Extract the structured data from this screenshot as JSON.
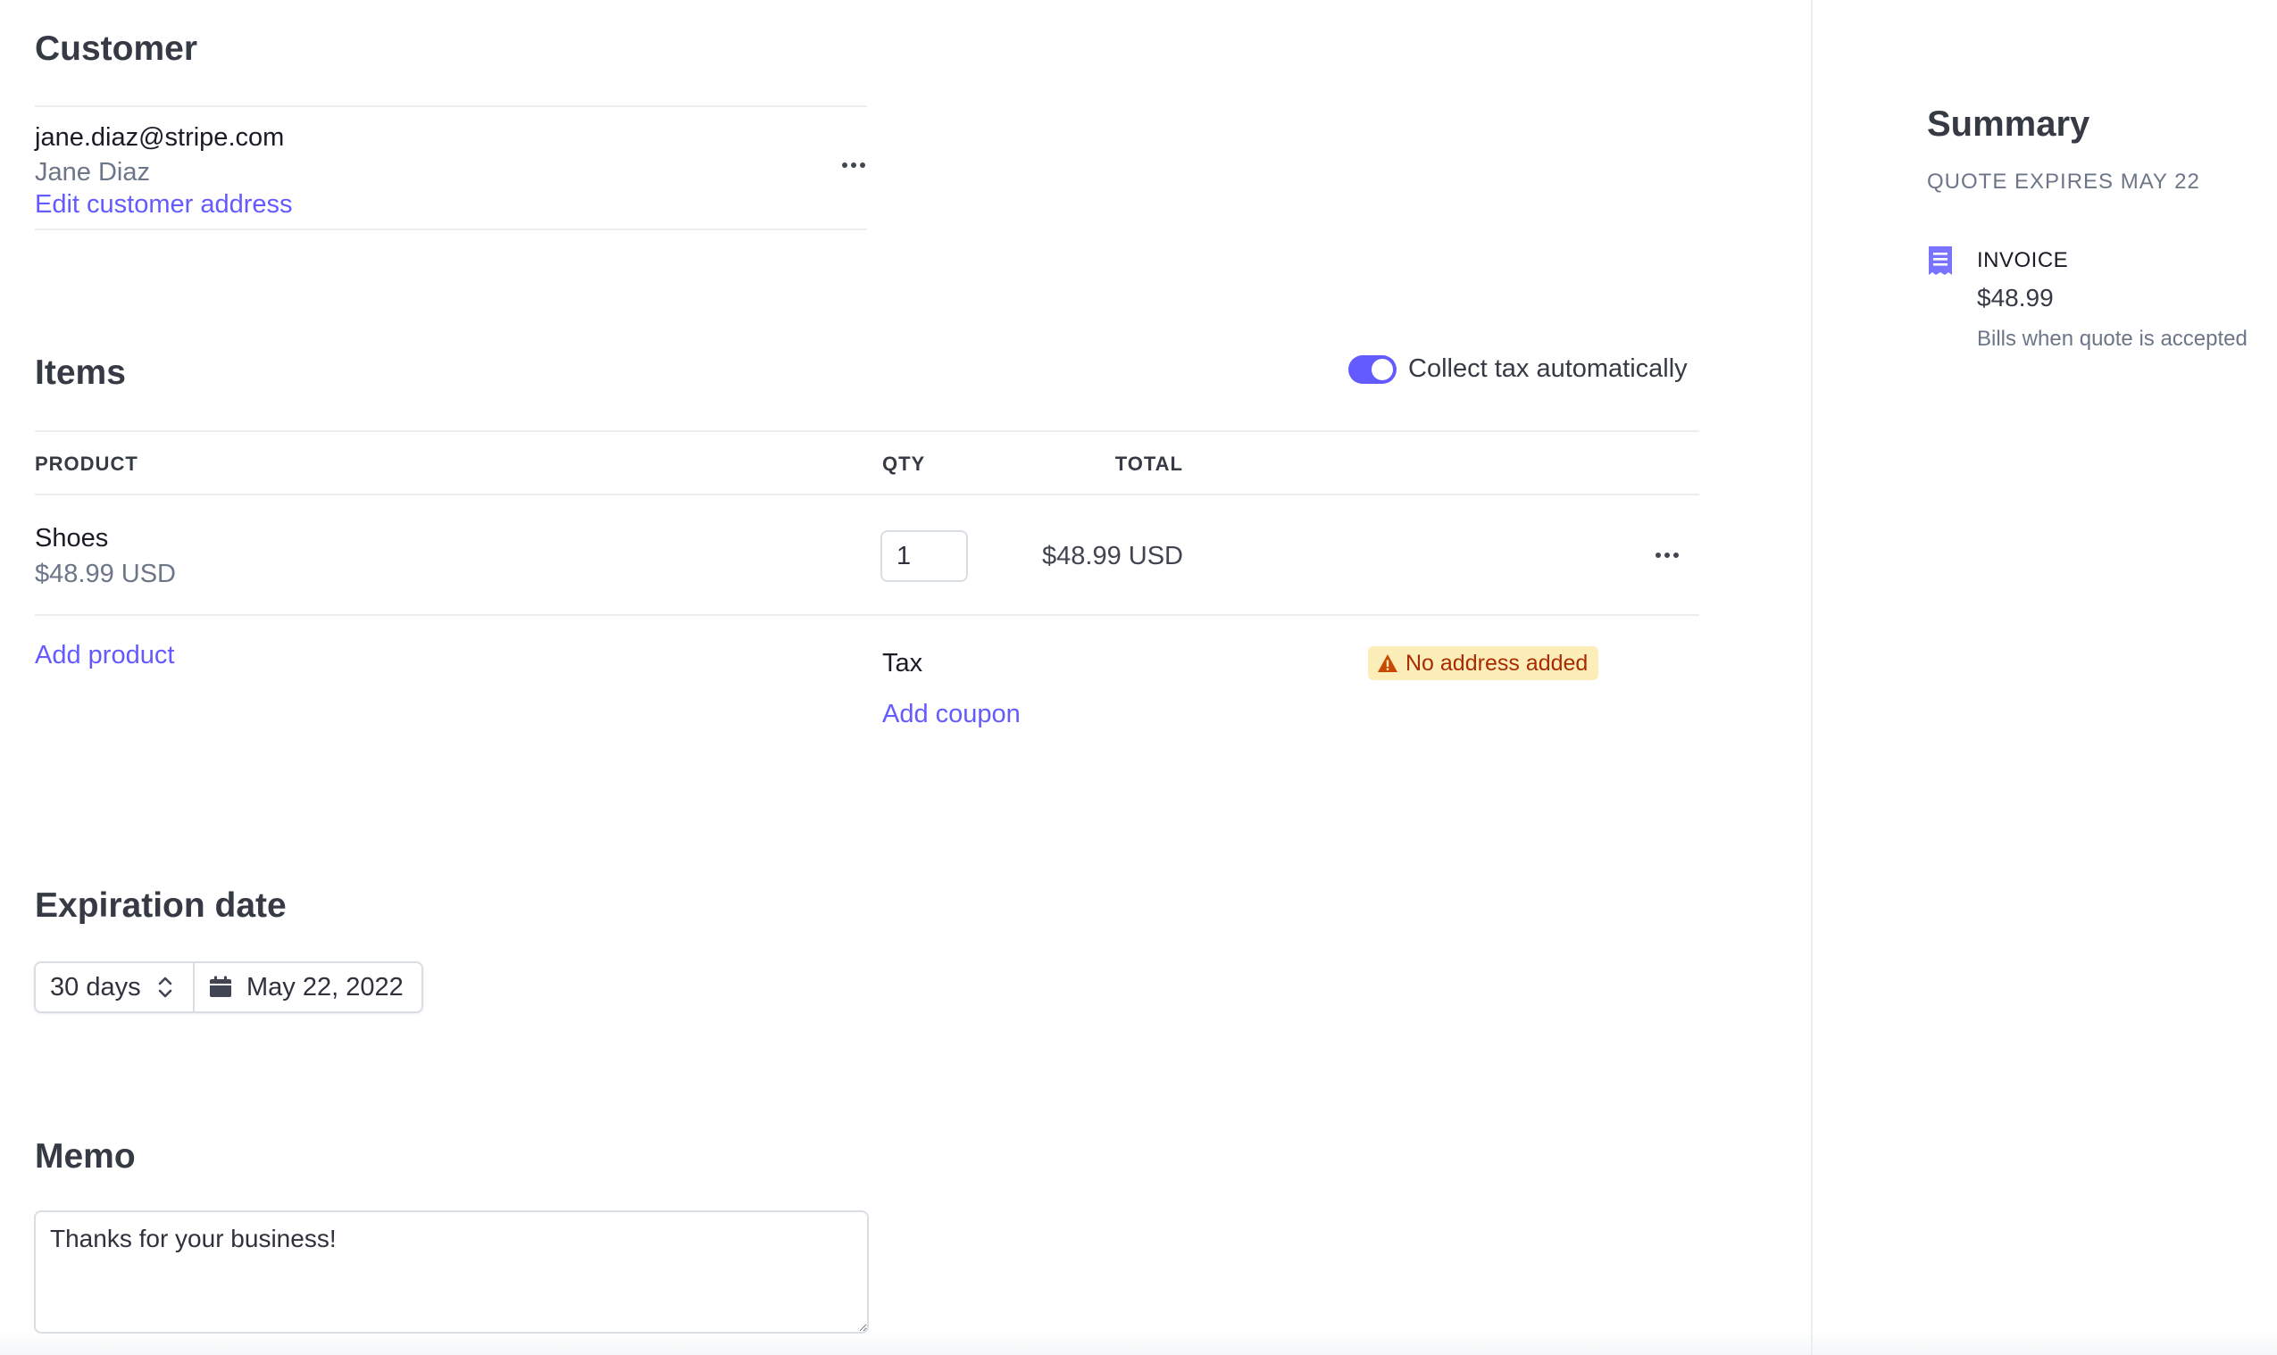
{
  "customer": {
    "heading": "Customer",
    "email": "jane.diaz@stripe.com",
    "name": "Jane Diaz",
    "edit_link": "Edit customer address",
    "more_icon": "more-horizontal-icon"
  },
  "items": {
    "heading": "Items",
    "collect_tax_label": "Collect tax automatically",
    "collect_tax_enabled": true,
    "columns": {
      "product": "PRODUCT",
      "qty": "QTY",
      "total": "TOTAL"
    },
    "rows": [
      {
        "name": "Shoes",
        "price": "$48.99 USD",
        "qty": "1",
        "total": "$48.99 USD"
      }
    ],
    "add_product": "Add product",
    "tax_label": "Tax",
    "tax_badge": "No address added",
    "add_coupon": "Add coupon"
  },
  "expiration": {
    "heading": "Expiration date",
    "duration": "30 days",
    "date": "May 22, 2022"
  },
  "memo": {
    "heading": "Memo",
    "value": "Thanks for your business!"
  },
  "summary": {
    "title": "Summary",
    "expires": "QUOTE EXPIRES MAY 22",
    "invoice_label": "INVOICE",
    "invoice_amount": "$48.99",
    "invoice_note": "Bills when quote is accepted"
  },
  "colors": {
    "accent": "#635bff",
    "warning_bg": "#fcedb9",
    "warning_text": "#a82c00",
    "border": "#ebeef1"
  }
}
